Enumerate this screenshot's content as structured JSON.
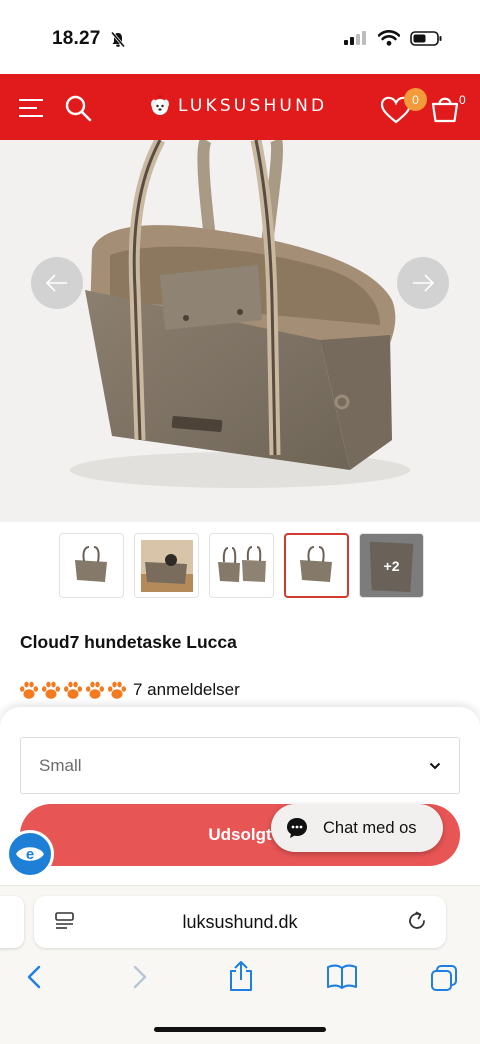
{
  "status_bar": {
    "time": "18.27"
  },
  "header": {
    "logo_text": "LUKSUSHUND",
    "wishlist_count": "0",
    "cart_count": "0"
  },
  "gallery": {
    "thumbnails_more_label": "+2"
  },
  "product": {
    "title": "Cloud7 hundetaske Lucca",
    "review_text": "7 anmeldelser"
  },
  "purchase": {
    "size_value": "Small",
    "button_label": "Udsolgt"
  },
  "chat": {
    "label": "Chat med os"
  },
  "browser": {
    "url": "luksushund.dk"
  },
  "colors": {
    "brand_red": "#e11b1b",
    "badge_orange": "#f39a3a",
    "paw_orange": "#f47a20",
    "sold_out_red": "#e85555",
    "safari_blue": "#1d7fe0"
  }
}
